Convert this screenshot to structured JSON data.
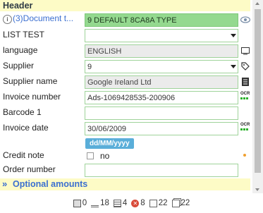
{
  "header": {
    "title": "Header"
  },
  "fields": {
    "document_type": {
      "label": "(3)Document t...",
      "value": "9 DEFAULT 8CA8A TYPE"
    },
    "list_test": {
      "label": "LIST TEST",
      "value": ""
    },
    "language": {
      "label": "language",
      "value": "ENGLISH"
    },
    "supplier": {
      "label": "Supplier",
      "value": "9"
    },
    "supplier_name": {
      "label": "Supplier name",
      "value": "Google Ireland Ltd"
    },
    "invoice_number": {
      "label": "Invoice number",
      "value": "Ads-1069428535-200906"
    },
    "barcode": {
      "label": "Barcode 1",
      "value": ""
    },
    "invoice_date": {
      "label": "Invoice date",
      "value": "30/06/2009",
      "hint": "dd/MM/yyyy"
    },
    "credit_note": {
      "label": "Credit note",
      "option": "no"
    },
    "order_number": {
      "label": "Order number",
      "value": ""
    }
  },
  "ocr_label": "OCR",
  "optional_section": {
    "chevron": "»",
    "title": "Optional amounts"
  },
  "status_bar": {
    "counts": [
      {
        "icon": "page-view-icon",
        "value": "0"
      },
      {
        "icon": "stack-icon",
        "value": "18"
      },
      {
        "icon": "list-icon",
        "value": "4"
      },
      {
        "icon": "error-icon",
        "value": "8"
      },
      {
        "icon": "document-icon",
        "value": "22"
      },
      {
        "icon": "documents-icon",
        "value": "22"
      }
    ]
  },
  "colors": {
    "accent_field": "#94d98f",
    "section_bg": "#fdfbc6",
    "link": "#3b6fd0",
    "hint": "#5aaed9"
  }
}
